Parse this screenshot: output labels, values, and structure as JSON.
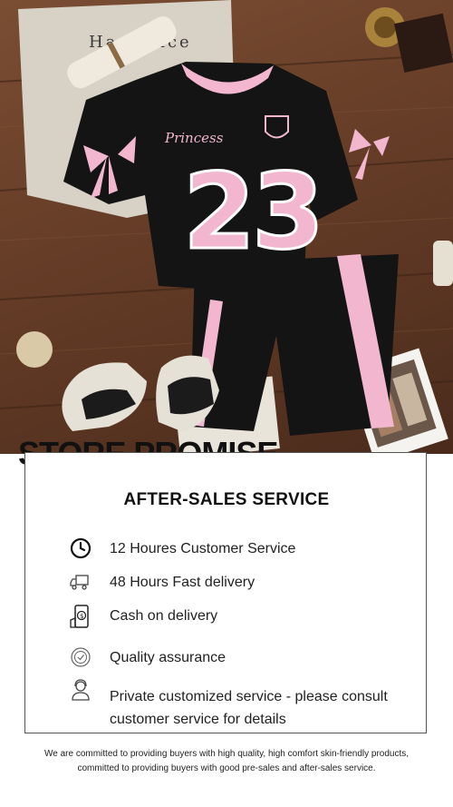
{
  "header": {
    "title": "STORE PROMISE"
  },
  "card": {
    "heading": "AFTER-SALES SERVICE",
    "items": [
      {
        "icon": "clock-icon",
        "label": "12 Houres Customer Service"
      },
      {
        "icon": "delivery-truck-icon",
        "label": "48 Hours Fast delivery"
      },
      {
        "icon": "phone-payment-icon",
        "label": "Cash on delivery"
      },
      {
        "icon": "quality-badge-icon",
        "label": "Quality assurance"
      },
      {
        "icon": "customer-service-agent-icon",
        "label_line1": "Private customized service - please consult",
        "label_line2": "customer service for details"
      }
    ]
  },
  "footer": {
    "line1": "We are committed to providing buyers with high quality, high comfort skin-friendly products,",
    "line2": "committed to providing buyers with good pre-sales and after-sales service."
  },
  "product_image": {
    "shirt_text": "Princess",
    "number": "23",
    "bag_text": "Ha  a nice",
    "colors": {
      "garment": "#141414",
      "accent_pink": "#f2b6cf",
      "wood": "#6a4029"
    }
  }
}
